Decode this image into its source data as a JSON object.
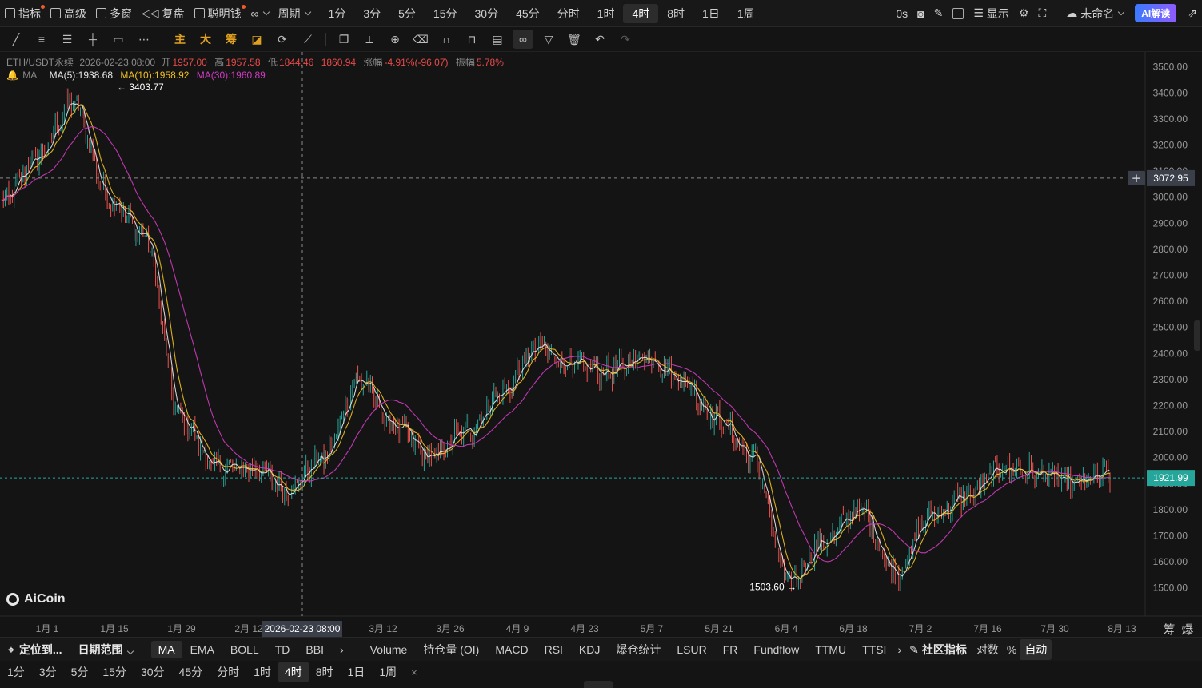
{
  "topbar": {
    "indicators": "指标",
    "advanced": "高级",
    "multi_window": "多窗",
    "replay": "复盘",
    "smart_money": "聪明钱",
    "period_menu": "周期",
    "periods": [
      "1分",
      "3分",
      "5分",
      "15分",
      "30分",
      "45分",
      "分时",
      "1时",
      "4时",
      "8时",
      "1日",
      "1周"
    ],
    "active_period": "4时",
    "countdown": "0s",
    "display": "显示",
    "layout_name": "未命名",
    "ai_button": "AI解读"
  },
  "drawbar": {
    "main_label": "主",
    "big_label": "大",
    "chip_label": "筹"
  },
  "legend": {
    "symbol": "ETH/USDT永续",
    "datetime": "2026-02-23 08:00",
    "open_label": "开",
    "open": "1957.00",
    "high_label": "高",
    "high": "1957.58",
    "low_label": "低",
    "low": "1844.46",
    "close_value": "1860.94",
    "change_label": "涨幅",
    "change": "-4.91%(-96.07)",
    "amp_label": "振幅",
    "amp": "5.78%",
    "ma_label": "MA",
    "ma5": "MA(5):1938.68",
    "ma10": "MA(10):1958.92",
    "ma30": "MA(30):1960.89"
  },
  "chart_data": {
    "type": "line",
    "symbol": "ETH/USDT永续",
    "timeframe": "4时",
    "ylim": [
      1450,
      3550
    ],
    "y_ticks": [
      "3500.00",
      "3400.00",
      "3300.00",
      "3200.00",
      "3100.00",
      "3000.00",
      "2900.00",
      "2800.00",
      "2700.00",
      "2600.00",
      "2500.00",
      "2400.00",
      "2300.00",
      "2200.00",
      "2100.00",
      "2000.00",
      "1900.00",
      "1800.00",
      "1700.00",
      "1600.00",
      "1500.00"
    ],
    "x_ticks": [
      "1月 1",
      "1月 15",
      "1月 29",
      "2月 12",
      "2月 26",
      "3月 12",
      "3月 26",
      "4月 9",
      "4月 23",
      "5月 7",
      "5月 21",
      "6月 4",
      "6月 18",
      "7月 2",
      "7月 16",
      "7月 30",
      "8月 13"
    ],
    "x": [
      "1月 1",
      "1月 8",
      "1月 15",
      "1月 22",
      "1月 29",
      "2月 5",
      "2月 12",
      "2月 19",
      "2月 26",
      "3月 5",
      "3月 12",
      "3月 19",
      "3月 26",
      "4月 2",
      "4月 9",
      "4月 16",
      "4月 23",
      "4月 30",
      "5月 7",
      "5月 14",
      "5月 21",
      "5月 28",
      "6月 4",
      "6月 11",
      "6月 18",
      "6月 25",
      "7月 2",
      "7月 9",
      "7月 16",
      "7月 23",
      "7月 30",
      "8月 6"
    ],
    "series": [
      {
        "values": [
          2980,
          3150,
          3360,
          3000,
          2850,
          2150,
          1960,
          1960,
          1880,
          2000,
          2300,
          2120,
          2000,
          2100,
          2250,
          2420,
          2350,
          2330,
          2390,
          2300,
          2150,
          2000,
          1520,
          1680,
          1800,
          1560,
          1780,
          1850,
          1960,
          1940,
          1900,
          1935
        ],
        "color": "#26a69a"
      }
    ],
    "max_label": "3403.77",
    "min_label": "1503.60",
    "crosshair_price": "3072.95",
    "crosshair_date": "2026-02-23 08:00",
    "last_price": "1921.99",
    "grid": false,
    "colors": {
      "up": "#26a69a",
      "down": "#ef5350",
      "ma5": "#e8e8e8",
      "ma10": "#f0c020",
      "ma30": "#d03cc0",
      "bg": "#141414"
    }
  },
  "corner": {
    "chip": "筹",
    "burst": "爆"
  },
  "indbar": {
    "locate": "定位到...",
    "date_range": "日期范围",
    "main_inds": [
      "MA",
      "EMA",
      "BOLL",
      "TD",
      "BBI"
    ],
    "active_main": "MA",
    "sub_inds": [
      "Volume",
      "持仓量 (OI)",
      "MACD",
      "RSI",
      "KDJ",
      "爆仓统计",
      "LSUR",
      "FR",
      "Fundflow",
      "TTMU",
      "TTSI"
    ],
    "community": "社区指标",
    "log": "对数",
    "percent": "%",
    "auto": "自动"
  },
  "periodbar": {
    "periods": [
      "1分",
      "3分",
      "5分",
      "15分",
      "30分",
      "45分",
      "分时",
      "1时",
      "4时",
      "8时",
      "1日",
      "1周"
    ],
    "active": "4时",
    "close": "×"
  }
}
